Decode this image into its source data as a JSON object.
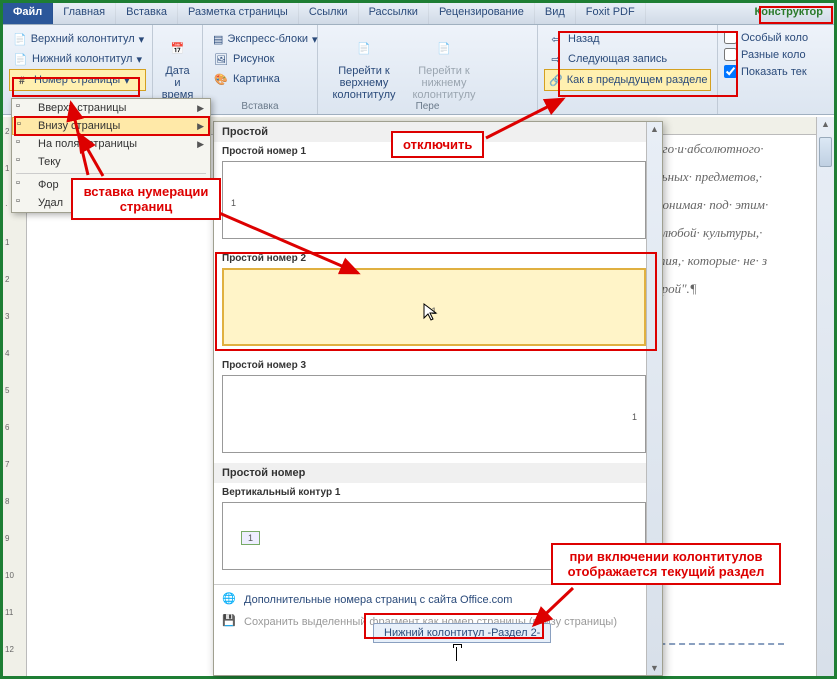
{
  "tabs": {
    "file": "Файл",
    "home": "Главная",
    "insert": "Вставка",
    "layout": "Разметка страницы",
    "references": "Ссылки",
    "mailings": "Рассылки",
    "review": "Рецензирование",
    "view": "Вид",
    "foxit": "Foxit PDF",
    "constructor": "Конструктор"
  },
  "ribbon": {
    "header": "Верхний колонтитул",
    "footer": "Нижний колонтитул",
    "pagenum": "Номер страницы",
    "datetime": "Дата и время",
    "express": "Экспресс-блоки",
    "picture": "Рисунок",
    "clipart": "Картинка",
    "group_insert": "Вставка",
    "gotoHeader": "Перейти к верхнему колонтитулу",
    "gotoFooter": "Перейти к нижнему колонтитулу",
    "group_nav_short": "Пере",
    "back": "Назад",
    "nextRecord": "Следующая запись",
    "linkPrev": "Как в предыдущем разделе",
    "special1": "Особый коло",
    "special2": "Разные коло",
    "showText": "Показать тек"
  },
  "dropdown": {
    "topOfPage": "Вверху страницы",
    "bottomOfPage": "Внизу страницы",
    "pageMargins": "На полях страницы",
    "current": "Теку",
    "format": "Фор",
    "remove": "Удал"
  },
  "gallery": {
    "section_plain": "Простой",
    "plain1": "Простой номер 1",
    "plain2": "Простой номер 2",
    "plain3": "Простой номер 3",
    "section_plainNum": "Простой номер",
    "vertical1": "Вертикальный контур 1",
    "moreOffice": "Дополнительные номера страниц с сайта Office.com",
    "saveSelection": "Сохранить выделенный фрагмент как номер страницы (внизу страницы)",
    "previewNum": "1"
  },
  "footer_tab": "Нижний колонтитул -Раздел 2-",
  "annotations": {
    "insertNumbering": "вставка нумерации страниц",
    "disable": "отключить",
    "footerSection": "при включении колонтитулов отображается текущий раздел"
  },
  "doc_text": {
    "l1": "ого·и·абсолютного·",
    "l2": "льных· предметов,·",
    "l3": "понимая· под· этим·",
    "l4": "· любой· культуры,·",
    "l5": "тия,· которые· не· з",
    "l6": "урой\".¶"
  },
  "ruler_ticks": [
    "2",
    "1",
    "·",
    "1",
    "2",
    "3",
    "4",
    "5",
    "6",
    "7",
    "8",
    "9",
    "10",
    "11",
    "12"
  ]
}
